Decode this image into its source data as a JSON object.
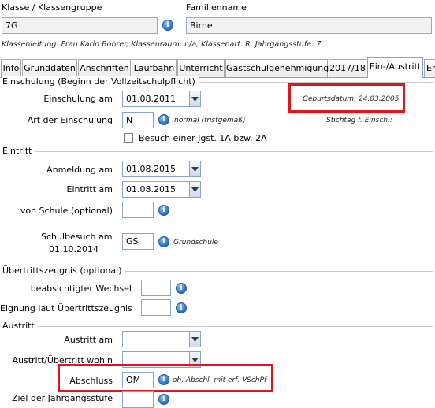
{
  "header": {
    "class_label": "Klasse / Klassengruppe",
    "class_value": "7G",
    "surname_label": "Familienname",
    "surname_value": "Birne",
    "class_info": "Klassenleitung: Frau Karin Bohrer, Klassenraum: n/a, Klassenart: R, Jahrgangsstufe: 7"
  },
  "tabs": [
    "Info",
    "Grunddaten",
    "Anschriften",
    "Laufbahn",
    "Unterricht",
    "Gastschulgenehmigung",
    "2017/18",
    "Ein-/Austritt",
    "Er"
  ],
  "active_tab": "Ein-/Austritt",
  "einschulung": {
    "title": "Einschulung (Beginn der Vollzeitschulpflicht)",
    "date_label": "Einschulung am",
    "date_value": "01.08.2011",
    "birth_label": "Geburtsdatum: 24.03.2005",
    "art_label": "Art der Einschulung",
    "art_value": "N",
    "art_hint": "normal (fristgemäß)",
    "stichtag_label": "Stichtag f. Einsch.:",
    "checkbox_label": "Besuch einer Jgst. 1A bzw. 2A"
  },
  "eintritt": {
    "title": "Eintritt",
    "anmeldung_label": "Anmeldung am",
    "anmeldung_value": "01.08.2015",
    "eintritt_label": "Eintritt am",
    "eintritt_value": "01.08.2015",
    "von_schule_label": "von Schule (optional)",
    "von_schule_value": "",
    "schulbesuch_label_1": "Schulbesuch am",
    "schulbesuch_label_2": "01.10.2014",
    "schulbesuch_value": "GS",
    "schulbesuch_hint": "Grundschule"
  },
  "uebertritt": {
    "title": "Übertrittszeugnis (optional)",
    "wechsel_label": "beabsichtigter Wechsel",
    "wechsel_value": "",
    "eignung_label": "Eignung laut Übertrittszeugnis",
    "eignung_value": ""
  },
  "austritt": {
    "title": "Austritt",
    "austritt_label": "Austritt am",
    "austritt_value": "",
    "wohin_label": "Austritt/Übertritt wohin",
    "wohin_value": "",
    "abschluss_label": "Abschluss",
    "abschluss_value": "OM",
    "abschluss_hint": "oh. Abschl. mit erf. VSchPf",
    "ziel_label": "Ziel der Jahrgangsstufe",
    "ziel_value": ""
  },
  "colors": {
    "highlight": "#e0141e",
    "field_border": "#8aa3c7",
    "info_icon": "#2a6fc0"
  },
  "icons": {
    "info": "info-icon",
    "dropdown": "chevron-down-icon"
  }
}
